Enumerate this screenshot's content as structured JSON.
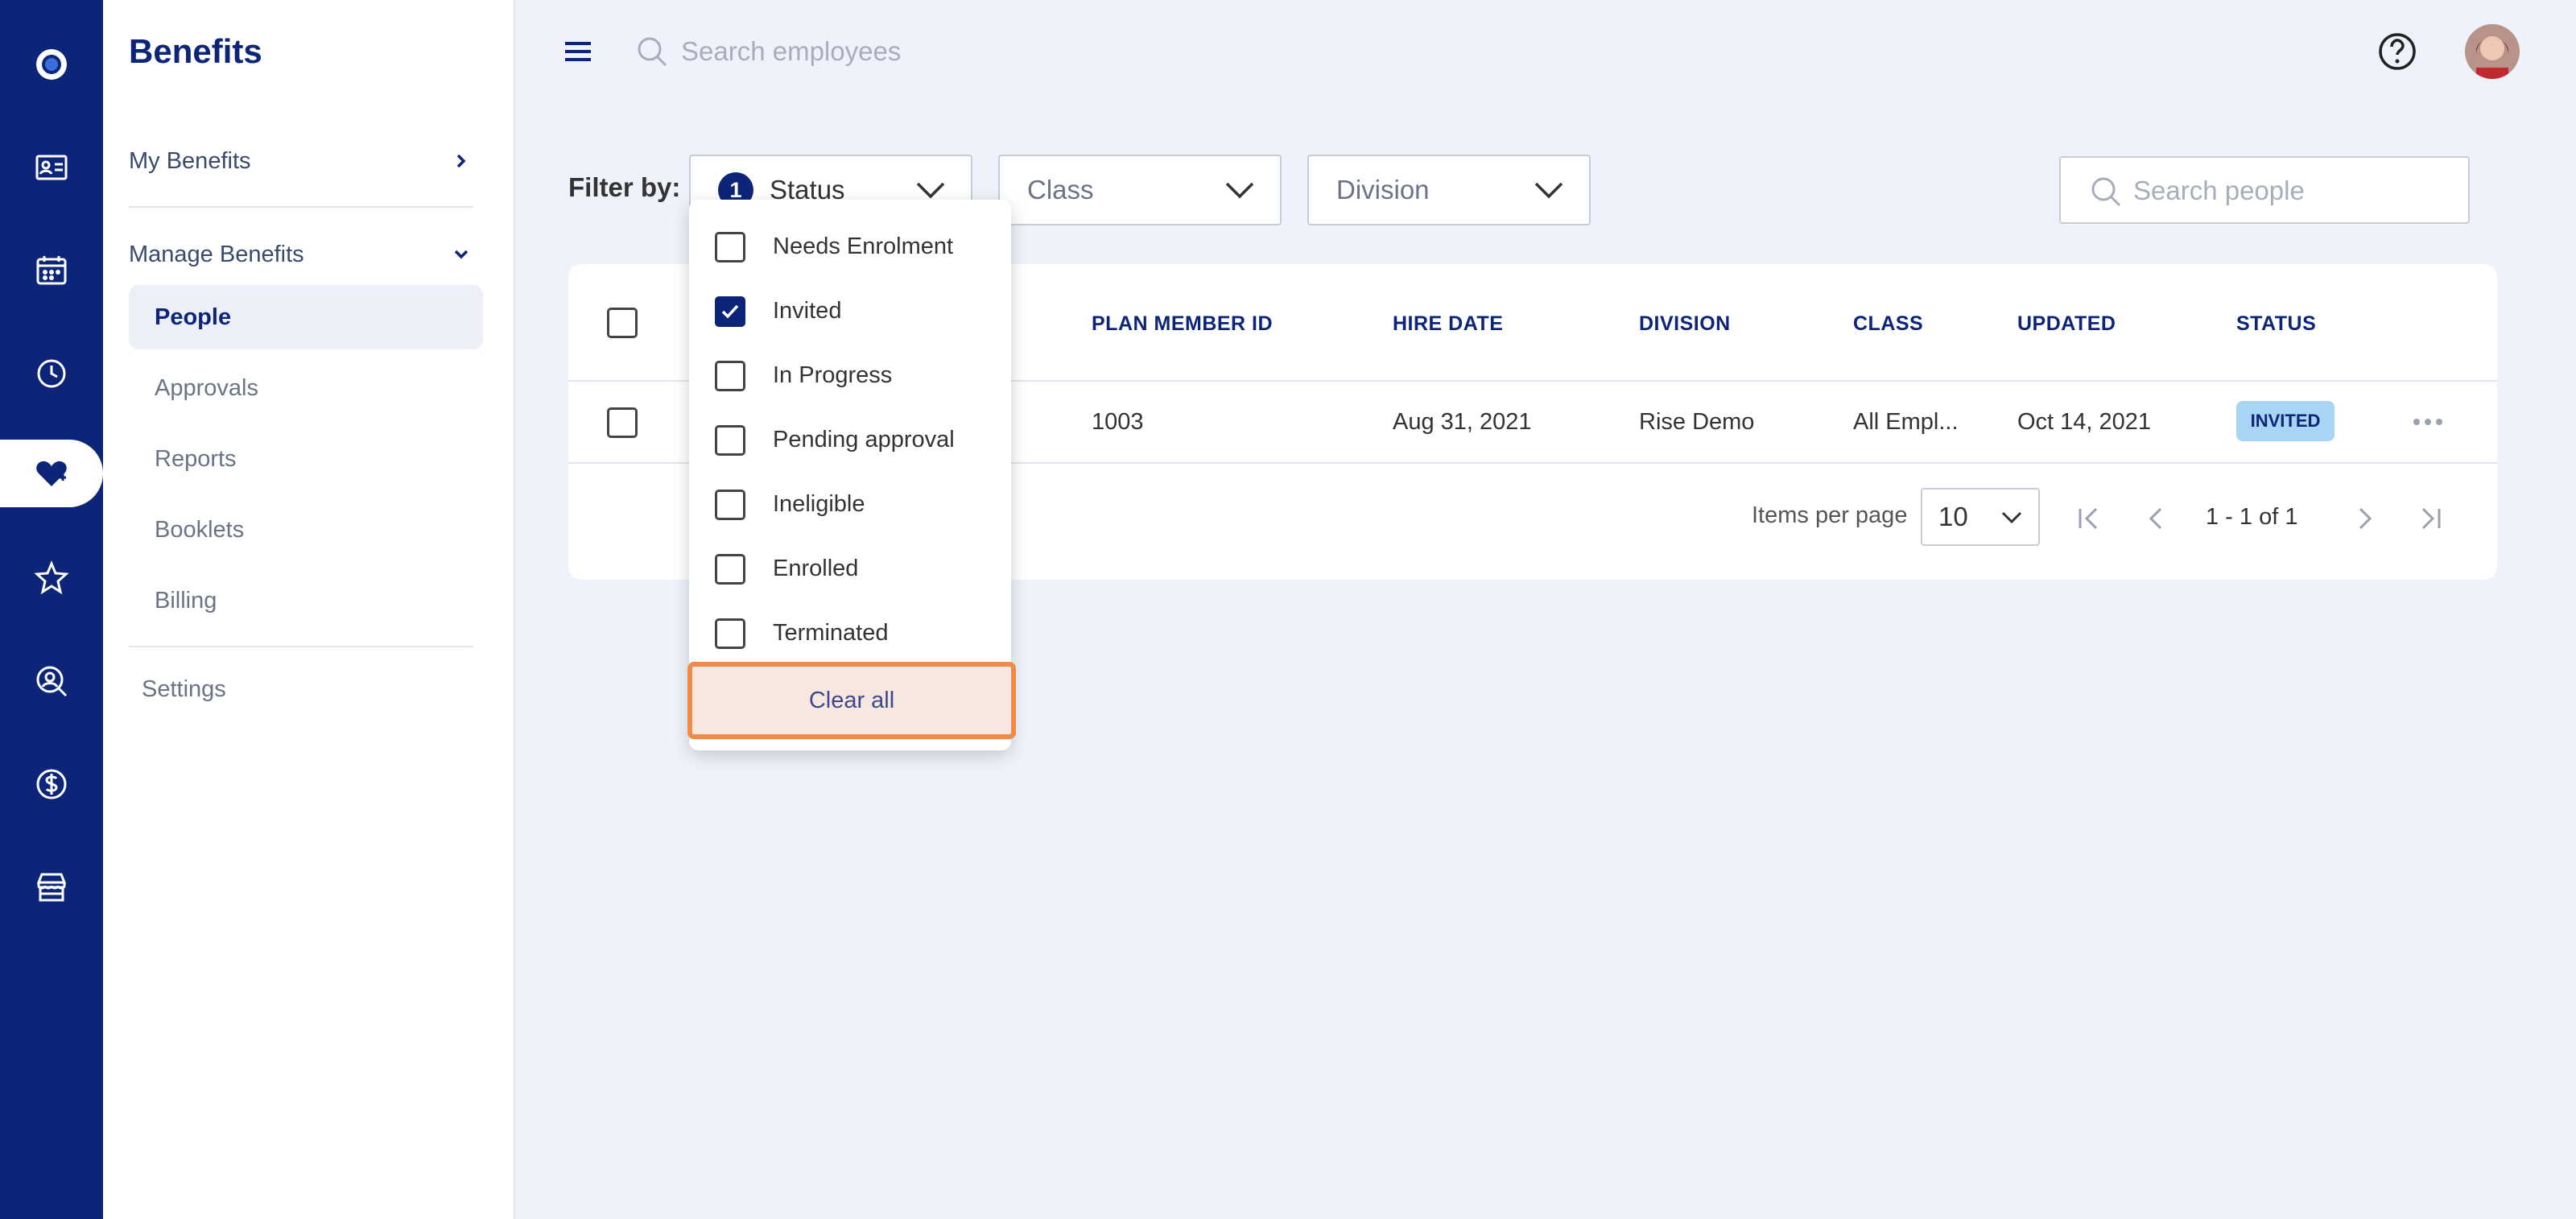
{
  "app": {
    "title": "Benefits"
  },
  "sidebar": {
    "my_benefits": "My Benefits",
    "manage_benefits": "Manage Benefits",
    "items": [
      {
        "label": "People"
      },
      {
        "label": "Approvals"
      },
      {
        "label": "Reports"
      },
      {
        "label": "Booklets"
      },
      {
        "label": "Billing"
      }
    ],
    "settings": "Settings"
  },
  "topbar": {
    "search_placeholder": "Search employees"
  },
  "filters": {
    "label": "Filter by:",
    "status": {
      "label": "Status",
      "count": "1"
    },
    "class": "Class",
    "division": "Division",
    "people_search_placeholder": "Search people"
  },
  "status_dropdown": {
    "options": [
      {
        "label": "Needs Enrolment",
        "checked": false
      },
      {
        "label": "Invited",
        "checked": true
      },
      {
        "label": "In Progress",
        "checked": false
      },
      {
        "label": "Pending approval",
        "checked": false
      },
      {
        "label": "Ineligible",
        "checked": false
      },
      {
        "label": "Enrolled",
        "checked": false
      },
      {
        "label": "Terminated",
        "checked": false
      }
    ],
    "clear_all": "Clear all"
  },
  "table": {
    "columns": [
      "PLAN MEMBER ID",
      "HIRE DATE",
      "DIVISION",
      "CLASS",
      "UPDATED",
      "STATUS"
    ],
    "rows": [
      {
        "plan_member_id": "1003",
        "hire_date": "Aug 31, 2021",
        "division": "Rise Demo",
        "class": "All Empl...",
        "updated": "Oct 14, 2021",
        "status": "INVITED"
      }
    ]
  },
  "pagination": {
    "items_per_page_label": "Items per page",
    "items_per_page": "10",
    "range": "1 - 1 of 1"
  },
  "colors": {
    "brand": "#0c2579",
    "status_invited": "#a8d4f5",
    "highlight": "#ef8a48"
  }
}
